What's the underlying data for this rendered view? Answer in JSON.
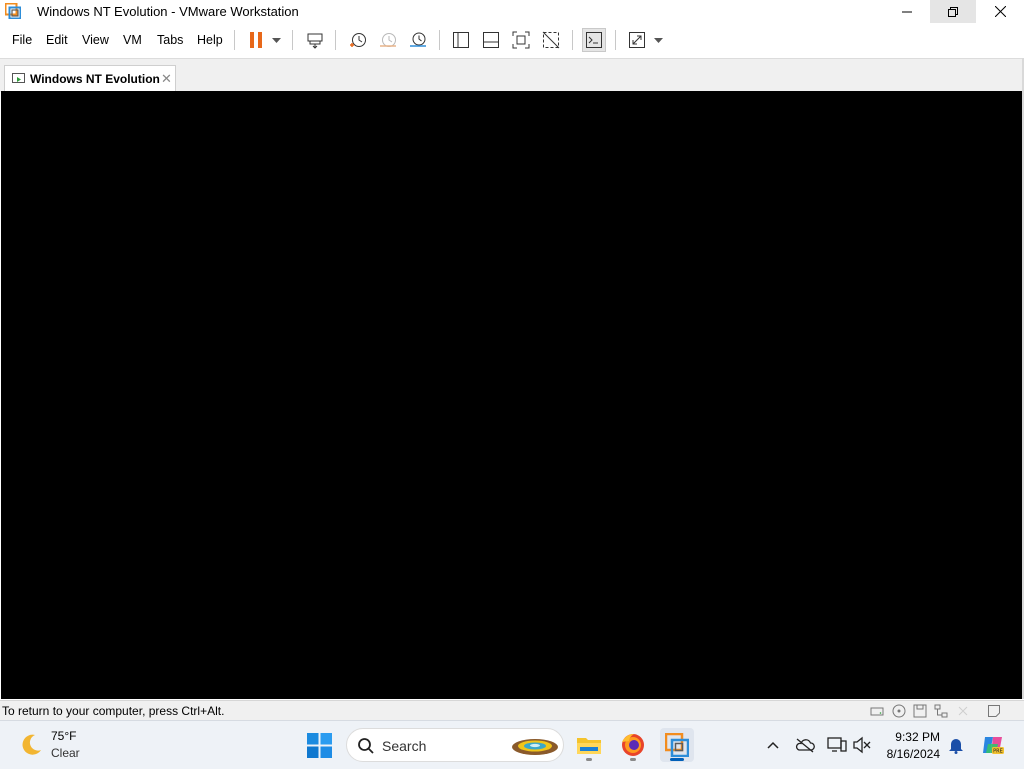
{
  "window": {
    "title": "Windows NT Evolution - VMware Workstation"
  },
  "menu": [
    "File",
    "Edit",
    "View",
    "VM",
    "Tabs",
    "Help"
  ],
  "toolbar": {
    "icons": [
      "power-pause-icon",
      "dropdown-arrow-icon",
      "send-ctrl-alt-del-icon",
      "take-snapshot-icon",
      "revert-snapshot-icon",
      "snapshot-manager-icon",
      "show-library-icon",
      "show-thumbnail-bar-icon",
      "full-screen-icon",
      "unity-icon",
      "console-view-icon",
      "stretch-guest-icon",
      "dropdown-arrow-icon"
    ]
  },
  "tab": {
    "label": "Windows NT Evolution"
  },
  "status": {
    "message": "To return to your computer, press Ctrl+Alt."
  },
  "taskbar": {
    "weather_temp": "75°F",
    "weather_condition": "Clear",
    "search_label": "Search",
    "time": "9:32 PM",
    "date": "8/16/2024",
    "pinned_apps": [
      "file-explorer-icon",
      "firefox-icon",
      "vmware-workstation-icon"
    ]
  },
  "colors": {
    "accent": "#005fb8",
    "pause": "#e8681a",
    "vm_screen": "#000000"
  }
}
